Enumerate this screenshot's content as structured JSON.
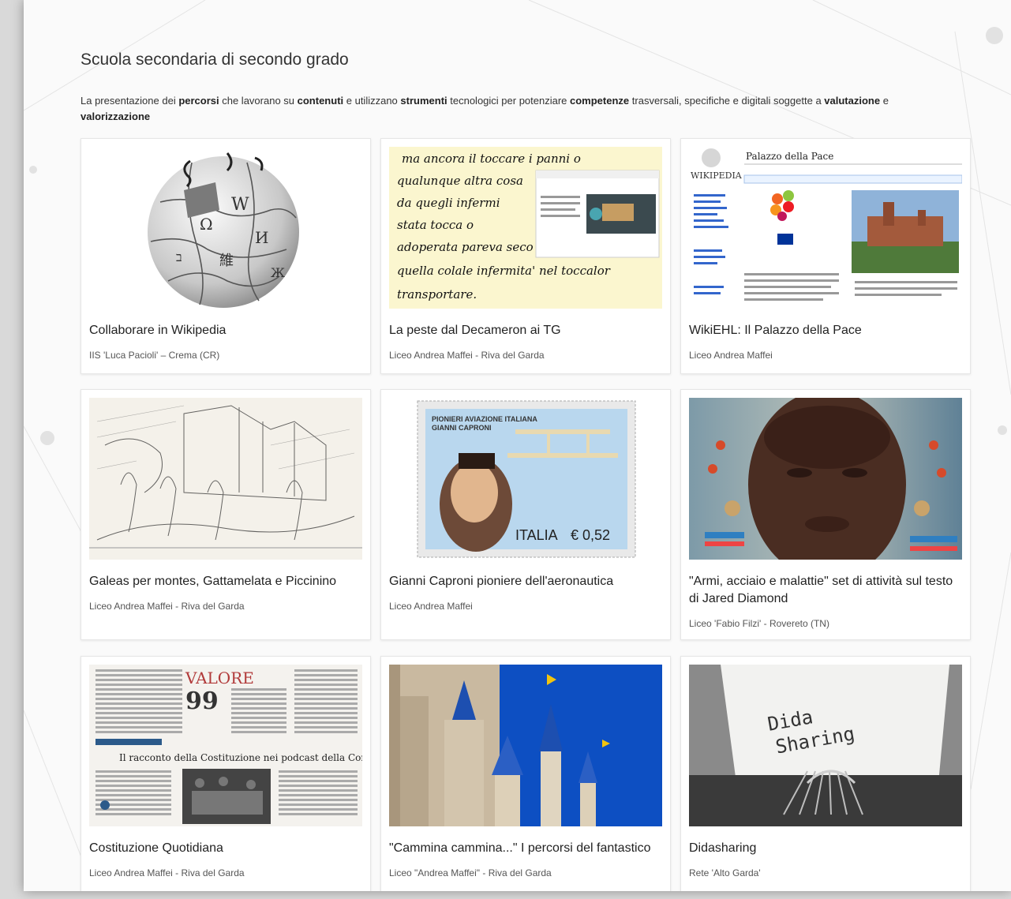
{
  "heading": "Scuola secondaria di secondo grado",
  "intro": [
    {
      "t": "La presentazione dei ",
      "b": false
    },
    {
      "t": "percorsi",
      "b": true
    },
    {
      "t": " che lavorano su ",
      "b": false
    },
    {
      "t": "contenuti",
      "b": true
    },
    {
      "t": " e utilizzano ",
      "b": false
    },
    {
      "t": "strumenti",
      "b": true
    },
    {
      "t": " tecnologici per potenziare ",
      "b": false
    },
    {
      "t": "competenze",
      "b": true
    },
    {
      "t": " trasversali, specifiche e digitali soggette a ",
      "b": false
    },
    {
      "t": "valutazione",
      "b": true
    },
    {
      "t": " e ",
      "b": false
    },
    {
      "t": "valorizzazione",
      "b": true
    }
  ],
  "cards": [
    {
      "title": "Collaborare in Wikipedia",
      "subtitle": "IIS 'Luca Pacioli' – Crema (CR)"
    },
    {
      "title": "La peste dal Decameron ai TG",
      "subtitle": "Liceo Andrea Maffei - Riva del Garda"
    },
    {
      "title": "WikiEHL: Il Palazzo della Pace",
      "subtitle": "Liceo Andrea Maffei"
    },
    {
      "title": "Galeas per montes, Gattamelata e Piccinino",
      "subtitle": "Liceo Andrea Maffei - Riva del Garda"
    },
    {
      "title": "Gianni Caproni pioniere dell'aeronautica",
      "subtitle": "Liceo Andrea Maffei"
    },
    {
      "title": "\"Armi, acciaio e malattie\" set di attività sul testo di Jared Diamond",
      "subtitle": "Liceo 'Fabio Filzi' - Rovereto (TN)"
    },
    {
      "title": "Costituzione Quotidiana",
      "subtitle": "Liceo Andrea Maffei - Riva del Garda"
    },
    {
      "title": "\"Cammina cammina...\" I percorsi del fantastico",
      "subtitle": "Liceo \"Andrea Maffei\" - Riva del Garda"
    },
    {
      "title": "Didasharing",
      "subtitle": "Rete 'Alto Garda'"
    }
  ],
  "images": {
    "decameron_lines": [
      "ma ancora il toccare i panni o",
      "qualunque altra cosa",
      "da quegli infermi",
      "stata tocca o",
      "adoperata pareva seco",
      "quella colale infermita' nel toccalor",
      "transportare."
    ],
    "wiki_article_title": "Palazzo della Pace",
    "wiki_wordmark": "WIKIPEDIA",
    "stamp_top": "PIONIERI AVIAZIONE ITALIANA",
    "stamp_name": "GIANNI CAPRONI",
    "stamp_country": "ITALIA",
    "stamp_value": "€ 0,52",
    "newspaper_title": "VALORE",
    "newspaper_headline": "Il racconto della Costituzione nei podcast della Corte",
    "typewriter_text_1": "Dida",
    "typewriter_text_2": "Sharing"
  }
}
